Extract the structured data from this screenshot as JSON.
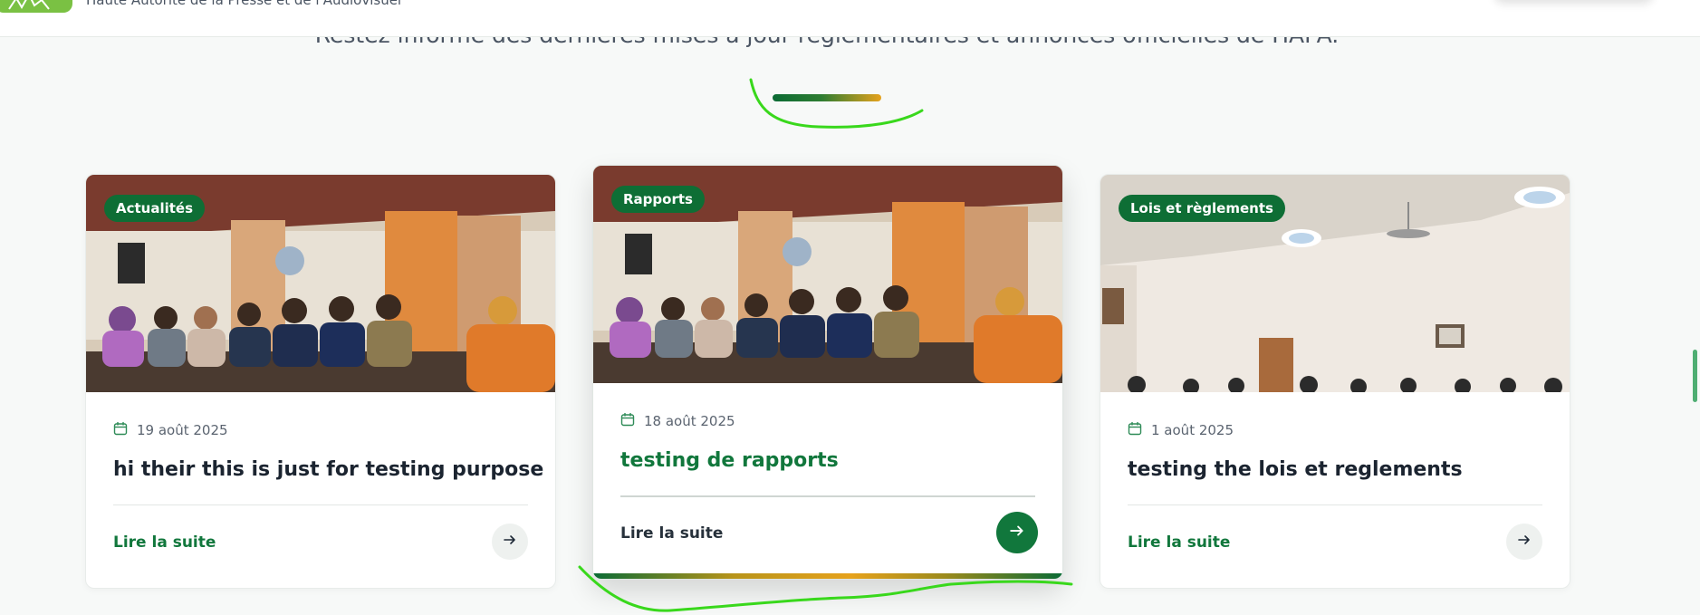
{
  "header": {
    "org_name": "Haute Autorité de la Presse et de l'Audiovisuel"
  },
  "section": {
    "subtitle": "Restez informé des dernières mises à jour réglementaires et annonces officielles de HAPA."
  },
  "colors": {
    "brand_green": "#0e6e35",
    "accent_gold": "#e6a21c",
    "logo_green": "#7ac143",
    "annotation_green": "#39d81c"
  },
  "cards": [
    {
      "category": "Actualités",
      "date": "19 août 2025",
      "title": "hi their this is just for testing purpose",
      "cta": "Lire la suite",
      "photo": "meeting-panel-photo",
      "icon": "calendar-icon"
    },
    {
      "category": "Rapports",
      "date": "18 août 2025",
      "title": "testing de rapports",
      "cta": "Lire la suite",
      "photo": "meeting-panel-photo",
      "icon": "calendar-icon",
      "state": "hover"
    },
    {
      "category": "Lois et règlements",
      "date": "1 août 2025",
      "title": "testing the lois et reglements",
      "cta": "Lire la suite",
      "photo": "conference-room-photo",
      "icon": "calendar-icon"
    }
  ]
}
